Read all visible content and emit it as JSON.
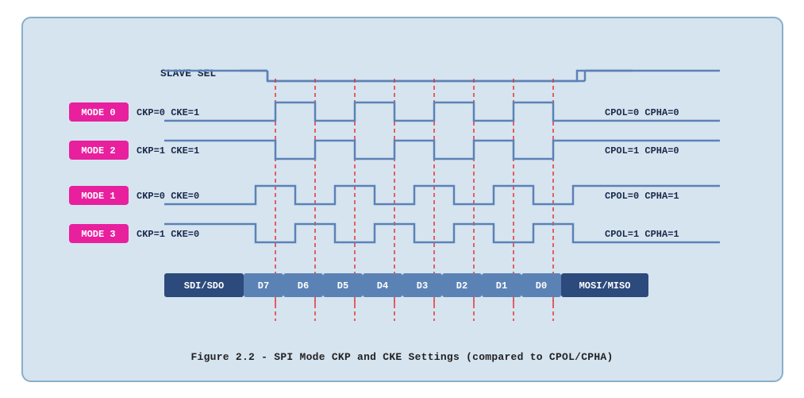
{
  "caption": "Figure 2.2 - SPI Mode CKP and CKE Settings (compared to CPOL/CPHA)",
  "diagram": {
    "slave_sel_label": "SLAVE SEL",
    "modes": [
      {
        "label": "MODE 0",
        "params": "CKP=0  CKE=1",
        "right": "CPOL=0  CPHA=0"
      },
      {
        "label": "MODE 2",
        "params": "CKP=1  CKE=1",
        "right": "CPOL=1  CPHA=0"
      },
      {
        "label": "MODE 1",
        "params": "CKP=0  CKE=0",
        "right": "CPOL=0  CPHA=1"
      },
      {
        "label": "MODE 3",
        "params": "CKP=1  CKE=0",
        "right": "CPOL=1  CPHA=1"
      }
    ],
    "data_labels": [
      "SDI/SDO",
      "D7",
      "D6",
      "D5",
      "D4",
      "D3",
      "D2",
      "D1",
      "D0",
      "MOSI/MISO"
    ]
  }
}
